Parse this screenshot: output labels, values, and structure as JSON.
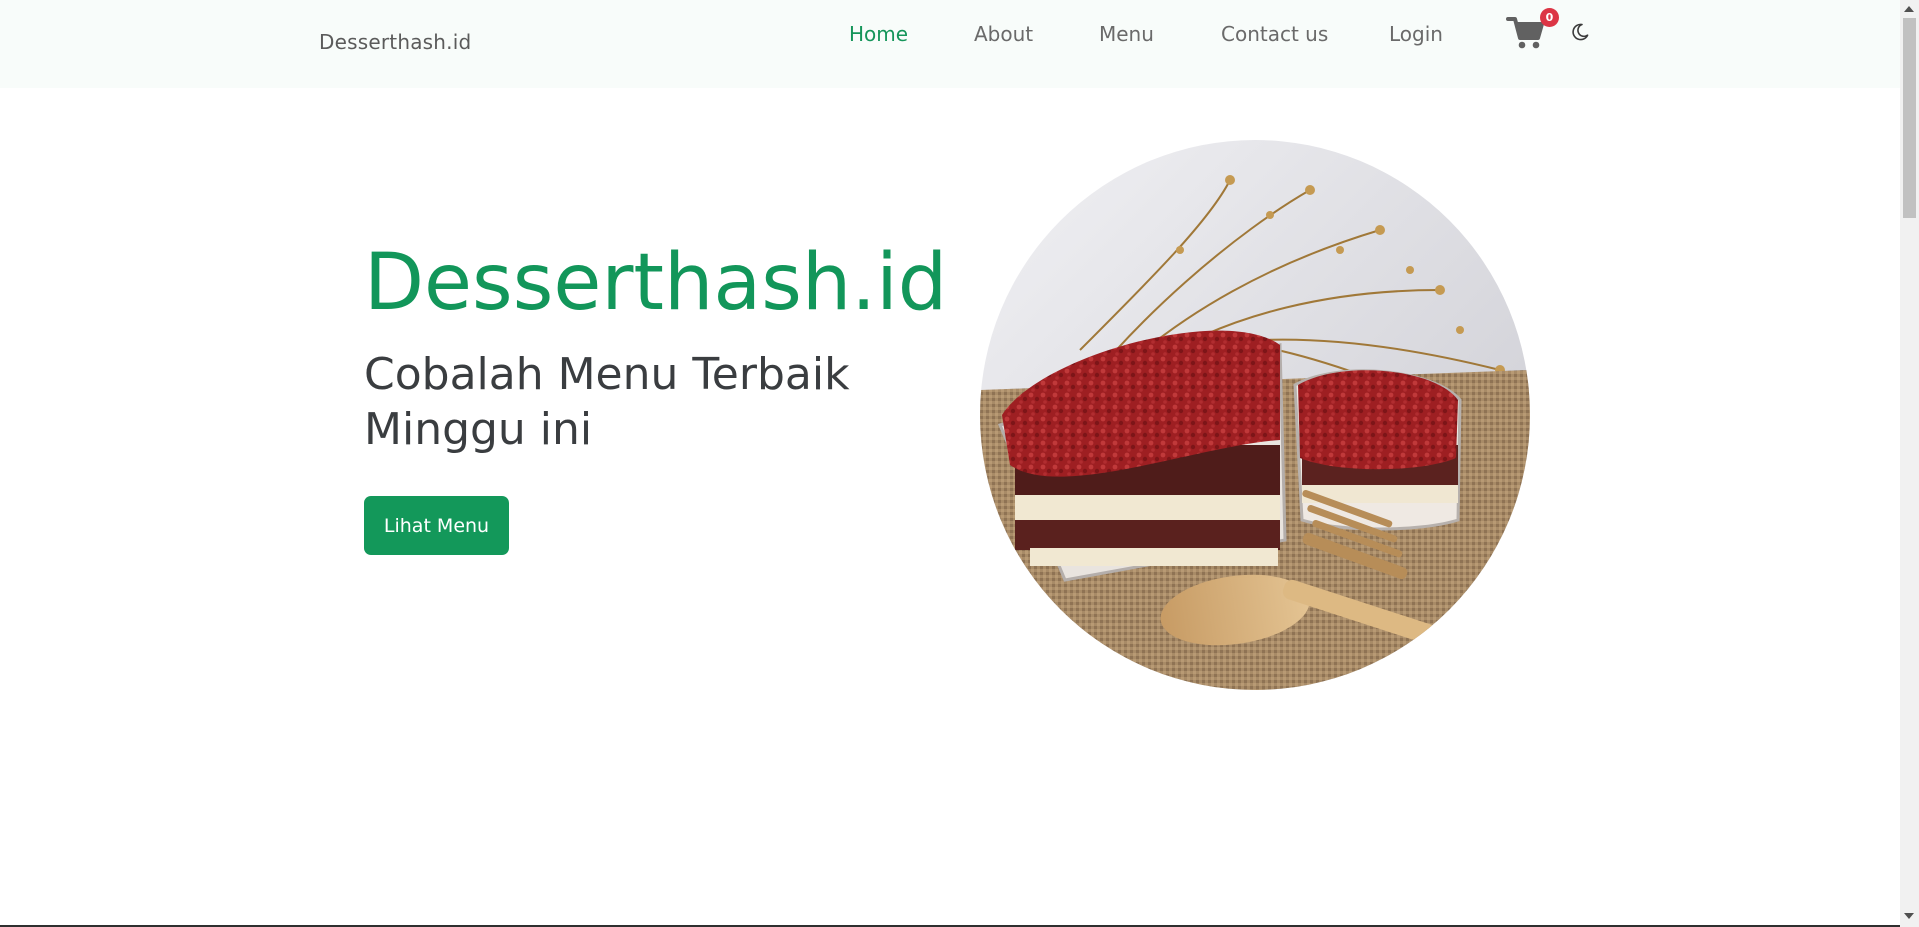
{
  "navbar": {
    "brand": "Desserthash.id",
    "links": [
      {
        "label": "Home",
        "active": true
      },
      {
        "label": "About",
        "active": false
      },
      {
        "label": "Menu",
        "active": false
      },
      {
        "label": "Contact us",
        "active": false
      },
      {
        "label": "Login",
        "active": false
      }
    ],
    "cart_icon": "shopping-cart-icon",
    "cart_count": "0",
    "theme_icon": "moon-icon"
  },
  "hero": {
    "title": "Desserthash.id",
    "subtitle": "Cobalah Menu Terbaik Minggu ini",
    "cta_label": "Lihat Menu",
    "image_icon": "dessert-photo"
  },
  "colors": {
    "accent": "#13985a",
    "active_link": "#15955a",
    "badge": "#dc3545",
    "navbar_bg": "#f8fcfa"
  }
}
